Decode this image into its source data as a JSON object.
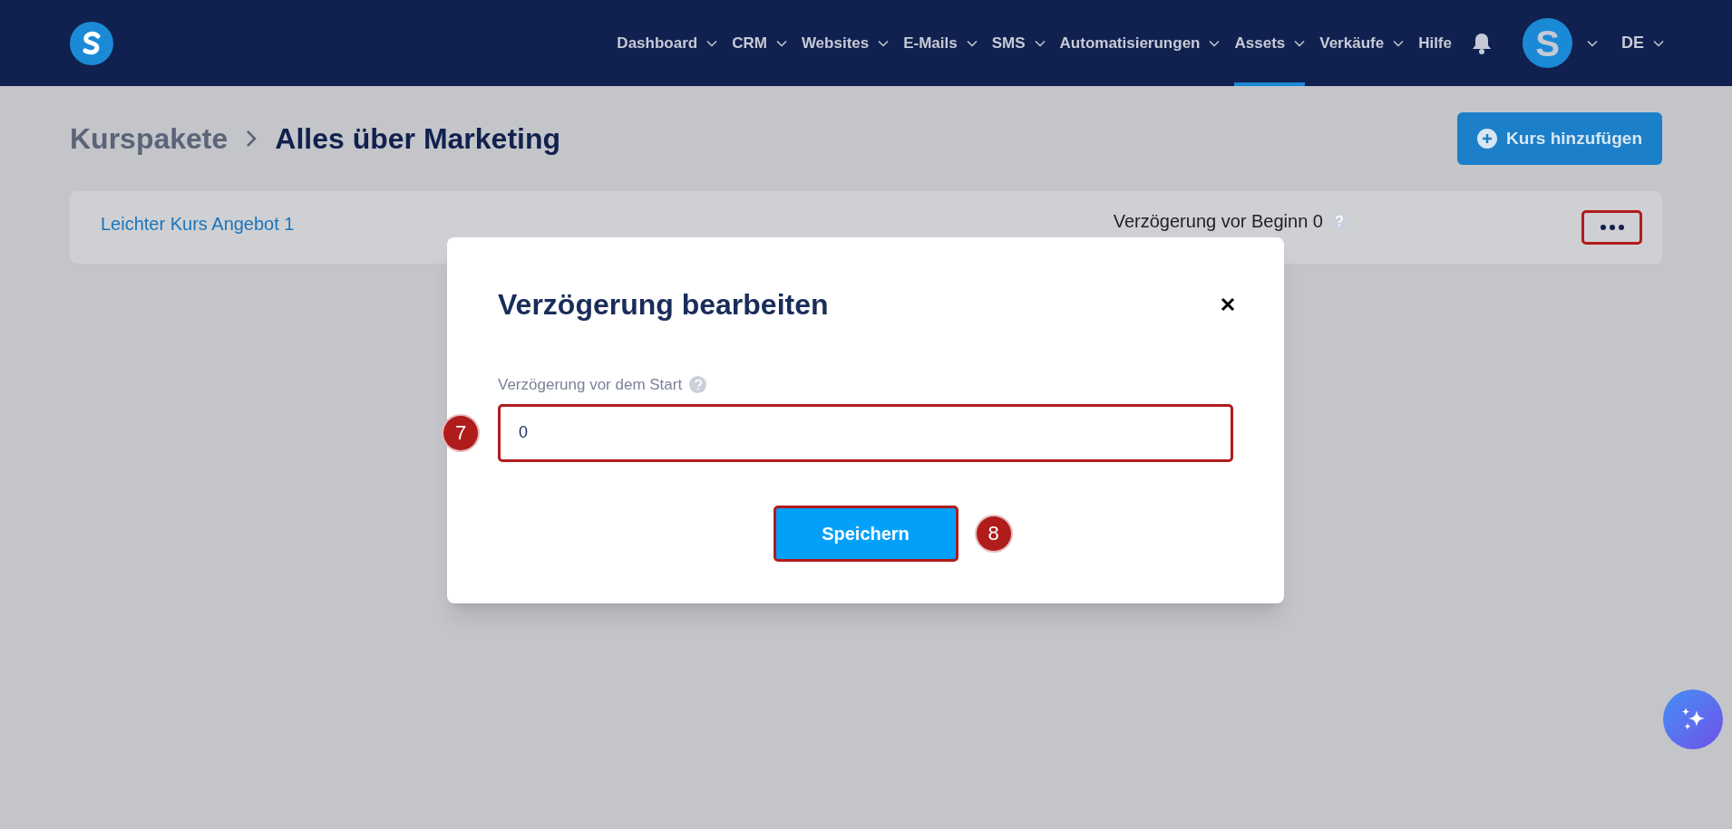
{
  "nav": {
    "items": [
      {
        "label": "Dashboard",
        "dropdown": true,
        "selected": false
      },
      {
        "label": "CRM",
        "dropdown": true,
        "selected": false
      },
      {
        "label": "Websites",
        "dropdown": true,
        "selected": false
      },
      {
        "label": "E-Mails",
        "dropdown": true,
        "selected": false
      },
      {
        "label": "SMS",
        "dropdown": true,
        "selected": false
      },
      {
        "label": "Automatisierungen",
        "dropdown": true,
        "selected": false
      },
      {
        "label": "Assets",
        "dropdown": true,
        "selected": true
      },
      {
        "label": "Verkäufe",
        "dropdown": true,
        "selected": false
      },
      {
        "label": "Hilfe",
        "dropdown": false,
        "selected": false
      }
    ],
    "avatar": "S",
    "language": "DE"
  },
  "breadcrumb": {
    "parent": "Kurspakete",
    "current": "Alles über Marketing"
  },
  "add_button": "Kurs hinzufügen",
  "course_row": {
    "title": "Leichter Kurs Angebot 1",
    "delay": "Verzögerung vor Beginn 0",
    "menu_highlighted": true
  },
  "modal": {
    "title": "Verzögerung bearbeiten",
    "field_label": "Verzögerung vor dem Start",
    "field_value": "0",
    "field_highlighted": true,
    "field_marker": "7",
    "save": "Speichern",
    "save_highlighted": true,
    "save_marker": "8"
  }
}
